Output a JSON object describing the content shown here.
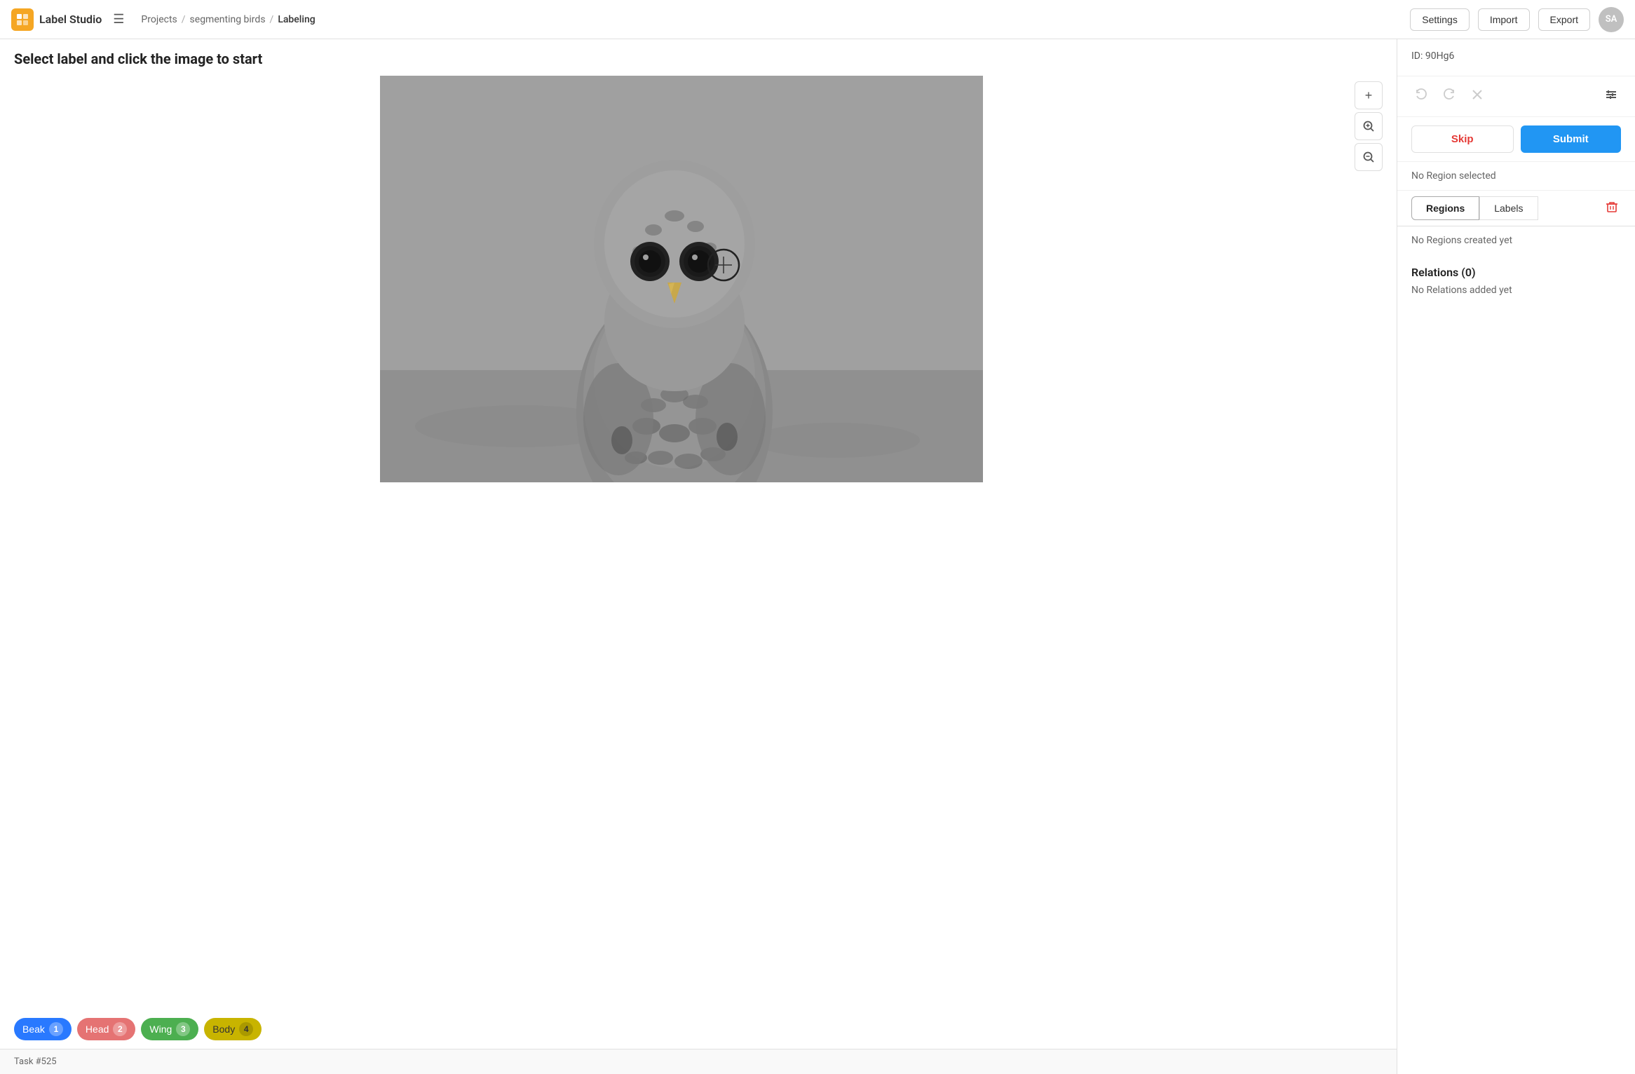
{
  "app": {
    "name": "Label Studio",
    "logo_symbol": "🟧"
  },
  "header": {
    "hamburger_label": "☰",
    "breadcrumb": {
      "projects": "Projects",
      "sep1": "/",
      "project": "segmenting birds",
      "sep2": "/",
      "current": "Labeling"
    },
    "settings_label": "Settings",
    "import_label": "Import",
    "export_label": "Export",
    "avatar_initials": "SA"
  },
  "instruction": "Select label and click the image to start",
  "sidebar": {
    "id": "ID: 90Hg6",
    "no_region": "No Region selected",
    "tabs": [
      {
        "label": "Regions",
        "active": true
      },
      {
        "label": "Labels",
        "active": false
      }
    ],
    "no_regions_created": "No Regions created yet",
    "relations_title": "Relations (0)",
    "no_relations": "No Relations added yet",
    "skip_label": "Skip",
    "submit_label": "Submit"
  },
  "labels": [
    {
      "name": "Beak",
      "number": "1",
      "color": "#2979ff"
    },
    {
      "name": "Head",
      "number": "2",
      "color": "#e57373"
    },
    {
      "name": "Wing",
      "number": "3",
      "color": "#4caf50"
    },
    {
      "name": "Body",
      "number": "4",
      "color": "#ffee58"
    }
  ],
  "footer": {
    "task_label": "Task #525"
  },
  "toolbar": {
    "zoom_in": "+",
    "zoom_fit": "⊕",
    "zoom_out": "−"
  }
}
